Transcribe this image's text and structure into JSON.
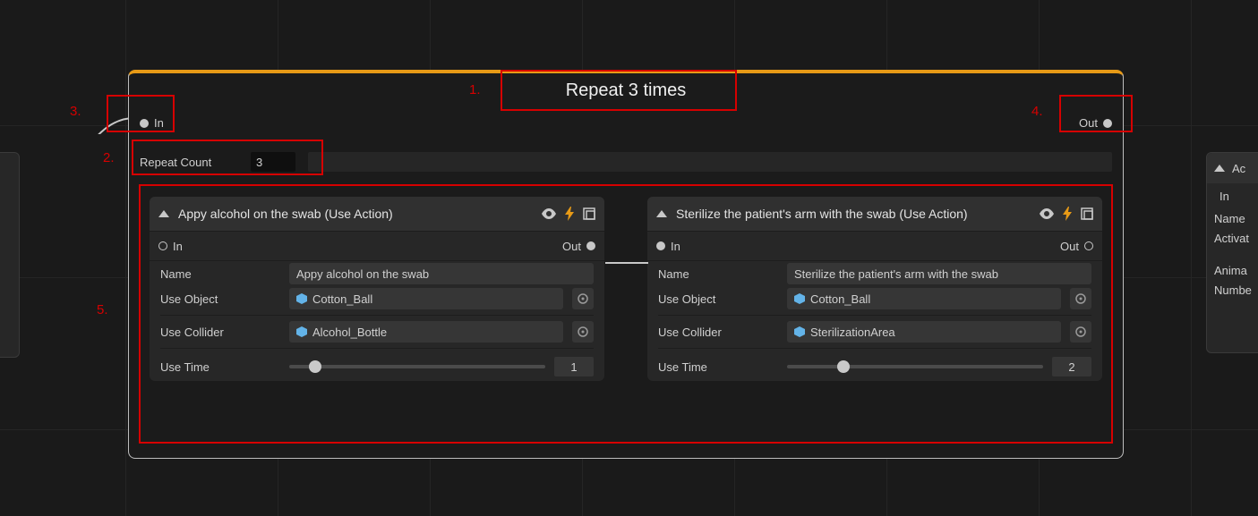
{
  "annotations": {
    "a1": "1.",
    "a2": "2.",
    "a3": "3.",
    "a4": "4.",
    "a5": "5."
  },
  "repeat_node": {
    "title": "Repeat 3 times",
    "in_label": "In",
    "out_label": "Out",
    "repeat_count_label": "Repeat Count",
    "repeat_count_value": "3"
  },
  "subnode_a": {
    "title": "Appy alcohol on the swab (Use Action)",
    "in_label": "In",
    "out_label": "Out",
    "name_label": "Name",
    "name_value": "Appy alcohol on the swab",
    "use_object_label": "Use Object",
    "use_object_value": "Cotton_Ball",
    "use_collider_label": "Use Collider",
    "use_collider_value": "Alcohol_Bottle",
    "use_time_label": "Use Time",
    "use_time_value": "1"
  },
  "subnode_b": {
    "title": "Sterilize the patient's arm with the swab (Use Action)",
    "in_label": "In",
    "out_label": "Out",
    "name_label": "Name",
    "name_value": "Sterilize the patient's arm with the swab",
    "use_object_label": "Use Object",
    "use_object_value": "Cotton_Ball",
    "use_collider_label": "Use Collider",
    "use_collider_value": "SterilizationArea",
    "use_time_label": "Use Time",
    "use_time_value": "2"
  },
  "right_node": {
    "header": "Ac",
    "in_label": "In",
    "name_label": "Name",
    "name_value": "Activat",
    "row1": "Anima",
    "row2": "Numbe"
  }
}
